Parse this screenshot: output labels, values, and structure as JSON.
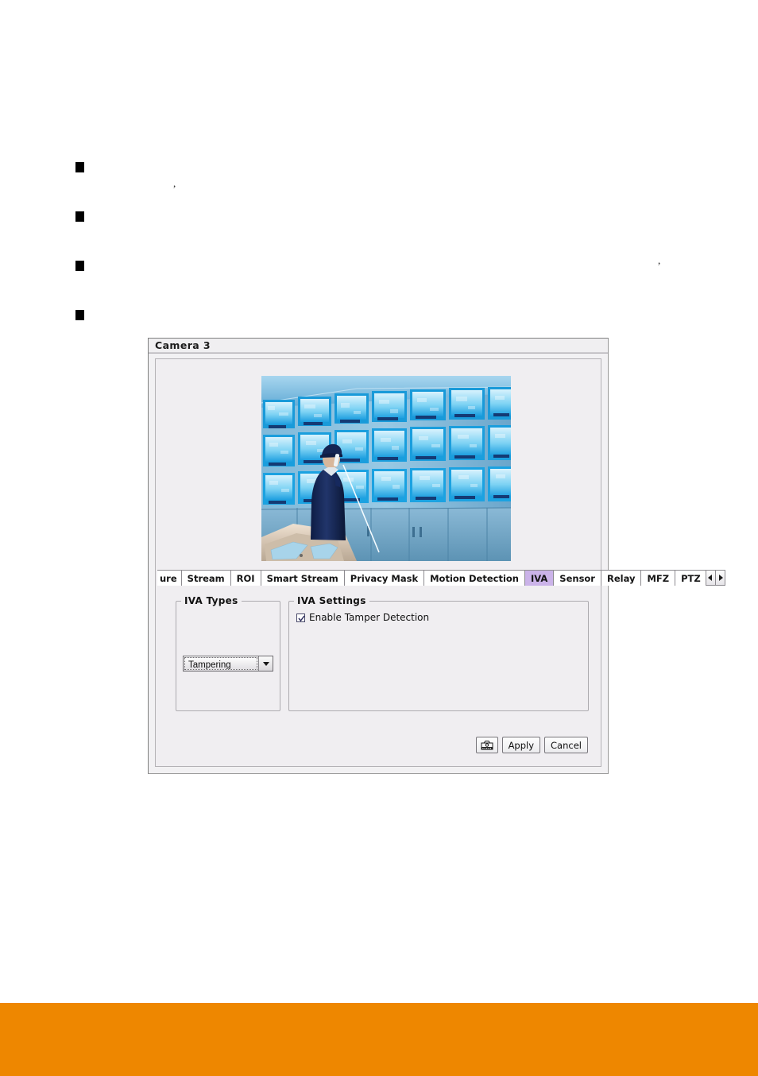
{
  "document": {
    "bullets": [
      {
        "marker": "square",
        "text": ""
      },
      {
        "marker": "square",
        "text": ""
      },
      {
        "marker": "square",
        "text": ""
      },
      {
        "marker": "square",
        "text": ""
      }
    ],
    "stray_marks": [
      ",",
      ","
    ]
  },
  "window": {
    "title": "Camera 3",
    "preview": {
      "alt": "Live camera preview: security operator in dark blue jacket and cap speaking on a telephone in front of a wall of blue-lit CCTV monitors",
      "colors": {
        "screen_blue": "#1fa7e8",
        "screen_bright": "#c9eefb",
        "cabinet": "#6fa9c8",
        "uniform": "#16295e",
        "console": "#c9c0b4"
      }
    }
  },
  "tabs": {
    "items": [
      {
        "label": "ure",
        "active": false,
        "clipped": true
      },
      {
        "label": "Stream",
        "active": false
      },
      {
        "label": "ROI",
        "active": false
      },
      {
        "label": "Smart Stream",
        "active": false
      },
      {
        "label": "Privacy Mask",
        "active": false
      },
      {
        "label": "Motion Detection",
        "active": false
      },
      {
        "label": "IVA",
        "active": true
      },
      {
        "label": "Sensor",
        "active": false
      },
      {
        "label": "Relay",
        "active": false
      },
      {
        "label": "MFZ",
        "active": false
      },
      {
        "label": "PTZ",
        "active": false
      }
    ],
    "active_tab": "IVA",
    "active_color": "#cbb3e9",
    "scroll_left_icon": "triangle-left-icon",
    "scroll_right_icon": "triangle-right-icon"
  },
  "iva_types": {
    "legend": "IVA Types",
    "selected": "Tampering",
    "options": [
      "Tampering"
    ]
  },
  "iva_settings": {
    "legend": "IVA Settings",
    "enable_tamper_detection": {
      "label": "Enable Tamper Detection",
      "checked": true
    }
  },
  "footer": {
    "snapshot_icon": "camera-snapshot-icon",
    "apply_label": "Apply",
    "cancel_label": "Cancel"
  },
  "page": {
    "accent_bar_color": "#ee8700"
  }
}
